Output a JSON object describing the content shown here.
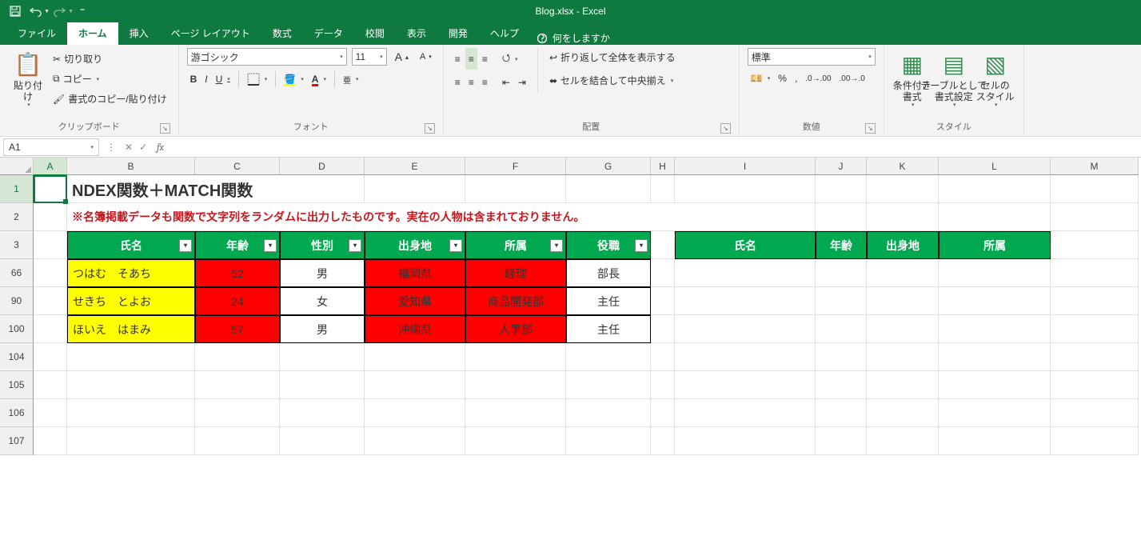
{
  "app": {
    "title": "Blog.xlsx  -  Excel"
  },
  "qat": {
    "save": "保存",
    "undo": "元に戻す",
    "redo": "やり直し"
  },
  "tabs": {
    "file": "ファイル",
    "items": [
      "ホーム",
      "挿入",
      "ページ レイアウト",
      "数式",
      "データ",
      "校閲",
      "表示",
      "開発",
      "ヘルプ"
    ],
    "active": "ホーム",
    "tellme": "何をしますか"
  },
  "ribbon": {
    "clipboard": {
      "paste": "貼り付け",
      "cut": "切り取り",
      "copy": "コピー",
      "format_painter": "書式のコピー/貼り付け",
      "label": "クリップボード"
    },
    "font": {
      "name": "游ゴシック",
      "size": "11",
      "bold": "B",
      "italic": "I",
      "underline": "U",
      "label": "フォント"
    },
    "alignment": {
      "wrap": "折り返して全体を表示する",
      "merge": "セルを結合して中央揃え",
      "label": "配置"
    },
    "number": {
      "format": "標準",
      "label": "数値"
    },
    "styles": {
      "cond": "条件付き\n書式",
      "table": "テーブルとして\n書式設定",
      "cell": "セルの\nスタイル",
      "label": "スタイル"
    }
  },
  "bar": {
    "namebox": "A1",
    "formula": ""
  },
  "columns": [
    {
      "k": "A",
      "w": 42
    },
    {
      "k": "B",
      "w": 160
    },
    {
      "k": "C",
      "w": 106
    },
    {
      "k": "D",
      "w": 106
    },
    {
      "k": "E",
      "w": 126
    },
    {
      "k": "F",
      "w": 126
    },
    {
      "k": "G",
      "w": 106
    },
    {
      "k": "H",
      "w": 30
    },
    {
      "k": "I",
      "w": 176
    },
    {
      "k": "J",
      "w": 64
    },
    {
      "k": "K",
      "w": 90
    },
    {
      "k": "L",
      "w": 140
    },
    {
      "k": "M",
      "w": 110
    }
  ],
  "rows": [
    "1",
    "2",
    "3",
    "66",
    "90",
    "100",
    "104",
    "105",
    "106",
    "107"
  ],
  "sheet": {
    "title": "NDEX関数＋MATCH関数",
    "note": "※名簿掲載データも関数で文字列をランダムに出力したものです。実在の人物は含まれておりません。",
    "headers": [
      "氏名",
      "年齢",
      "性別",
      "出身地",
      "所属",
      "役職"
    ],
    "headers2": [
      "氏名",
      "年齢",
      "出身地",
      "所属"
    ],
    "data": [
      {
        "name": "つはむ　そあち",
        "age": "52",
        "sex": "男",
        "pref": "福岡県",
        "dept": "経理",
        "role": "部長"
      },
      {
        "name": "せきち　とよお",
        "age": "24",
        "sex": "女",
        "pref": "愛知県",
        "dept": "商品開発部",
        "role": "主任"
      },
      {
        "name": "ほいえ　はまみ",
        "age": "57",
        "sex": "男",
        "pref": "沖縄県",
        "dept": "人事部",
        "role": "主任"
      }
    ]
  }
}
